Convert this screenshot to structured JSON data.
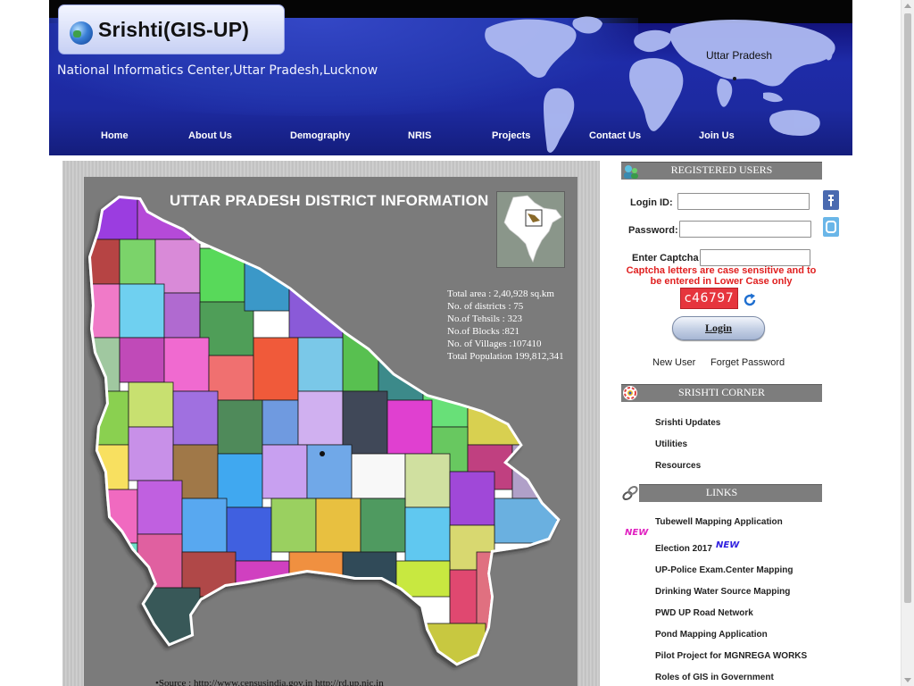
{
  "header": {
    "logo_title": "Srishti(GIS-UP)",
    "org_name": "National Informatics Center,Uttar Pradesh,Lucknow",
    "state_label": "Uttar Pradesh",
    "nav": [
      {
        "label": "Home"
      },
      {
        "label": "About Us"
      },
      {
        "label": "Demography"
      },
      {
        "label": "NRIS"
      },
      {
        "label": "Projects"
      },
      {
        "label": "Contact Us"
      },
      {
        "label": "Join Us"
      }
    ]
  },
  "map_panel": {
    "title": "UTTAR PRADESH DISTRICT INFORMATION",
    "stats": [
      "Total area : 2,40,928 sq.km",
      "No. of districts : 75",
      "No.of Tehsils : 323",
      "No.of Blocks :821",
      "No. of Villages :107410",
      "Total Population 199,812,341"
    ],
    "source": "•Source : http://www.censusindia.gov.in http://rd.up.nic.in"
  },
  "login": {
    "header": "REGISTERED USERS",
    "login_id_label": "Login ID:",
    "login_id_value": "",
    "password_label": "Password:",
    "password_value": "",
    "captcha_label": "Enter Captcha :",
    "captcha_value": "",
    "captcha_note": "Captcha letters are case sensitive and to be entered in Lower Case only",
    "captcha_text": "c46797",
    "login_button": "Login",
    "new_user": "New User",
    "forget_password": "Forget Password"
  },
  "srishti_corner": {
    "header": "SRISHTI CORNER",
    "items": [
      "Srishti Updates",
      "Utilities",
      "Resources"
    ]
  },
  "links": {
    "header": "LINKS",
    "new_badge": "NEW",
    "items": [
      "Tubewell Mapping Application",
      "Election 2017",
      "UP-Police Exam.Center Mapping",
      "Drinking Water Source Mapping",
      "PWD UP Road Network",
      "Pond Mapping Application",
      "Pilot Project for MGNREGA WORKS",
      "Roles of GIS in Government"
    ]
  },
  "colors": {
    "header_blue": "#1e2ba8",
    "section_header_gray": "#7d7d7d",
    "captcha_red": "#e02020",
    "map_background": "#7b7b7b"
  },
  "icons": {
    "social": [
      "facebook-icon",
      "social-share-icon"
    ],
    "captcha_refresh": "refresh-icon",
    "logo": "globe-icon"
  }
}
